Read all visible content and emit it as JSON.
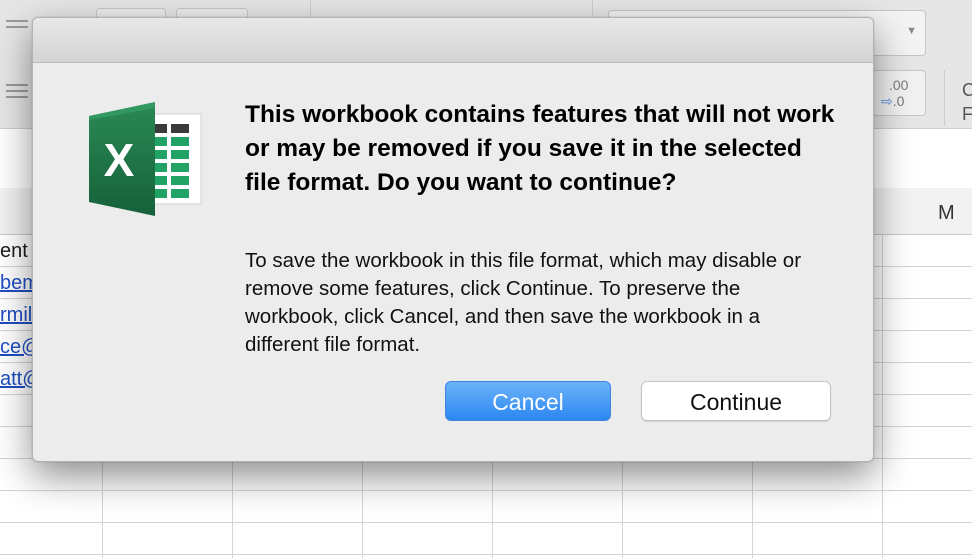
{
  "spreadsheet": {
    "column_header_visible": "M",
    "partial_cells": [
      {
        "text": "ent",
        "is_link": false
      },
      {
        "text": "bem",
        "is_link": true
      },
      {
        "text": "rmil",
        "is_link": true
      },
      {
        "text": "ce@",
        "is_link": true
      },
      {
        "text": "att@",
        "is_link": true
      }
    ],
    "toolbar": {
      "decimal_button_top": ".00",
      "decimal_button_bottom": ".0",
      "decimal_arrow": "⇨",
      "dropdown_chevron": "▼",
      "edge_text_top": "C",
      "edge_text_bottom": "F"
    }
  },
  "dialog": {
    "icon": "excel-app-icon",
    "icon_letter": "X",
    "heading": "This workbook contains features that will not work or may be removed if you save it in the selected file format. Do you want to continue?",
    "body": "To save the workbook in this file format, which may disable or remove some features, click Continue. To preserve the workbook, click Cancel, and then save the workbook in a different file format.",
    "buttons": {
      "cancel_label": "Cancel",
      "continue_label": "Continue"
    }
  },
  "colors": {
    "primary_button": "#2c87f0",
    "excel_green": "#1e7145",
    "link": "#1f4ec3"
  }
}
